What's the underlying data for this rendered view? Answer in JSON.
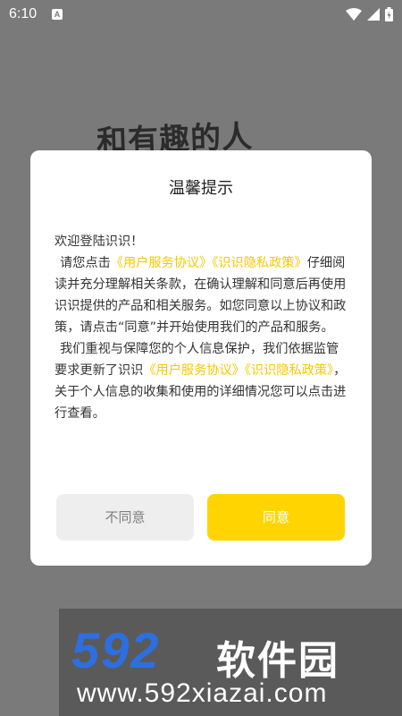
{
  "status_bar": {
    "time": "6:10",
    "notification_icon_letter": "A"
  },
  "background": {
    "headline": "和有趣的人"
  },
  "dialog": {
    "title": "温馨提示",
    "greeting": "欢迎登陆识识！",
    "p2_before": "请您点击",
    "link_user_agreement": "《用户服务协议》",
    "link_privacy_policy": "《识识隐私政策》",
    "p2_after": "仔细阅读并充分理解相关条款，在确认理解和同意后再使用识识提供的产品和相关服务。如您同意以上协议和政策，请点击“同意”并开始使用我们的产品和服务。",
    "p3_before": "我们重视与保障您的个人信息保护，我们依据监管要求更新了识识",
    "p3_after": "，关于个人信息的收集和使用的详细情况您可以点击进行查看。",
    "disagree_label": "不同意",
    "agree_label": "同意"
  },
  "watermark": {
    "logo_number": "592",
    "logo_text": "软件园",
    "url": "www.592xiazai.com"
  },
  "colors": {
    "accent": "#ffd400",
    "link": "#f5c800",
    "overlay": "#7a7a7a"
  }
}
